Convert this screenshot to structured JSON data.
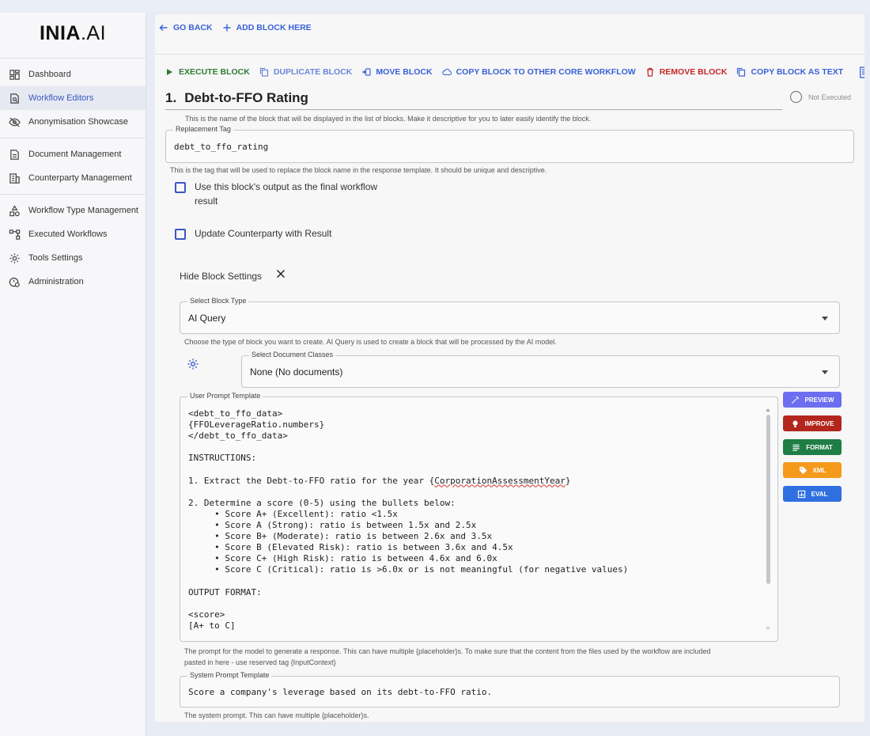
{
  "app": {
    "logo_bold": "INIA",
    "logo_rest": ".AI"
  },
  "sidebar": {
    "items": [
      {
        "label": "Dashboard",
        "icon": "dashboard-icon"
      },
      {
        "label": "Workflow Editors",
        "icon": "workflow-editor-icon",
        "active": true
      },
      {
        "label": "Anonymisation Showcase",
        "icon": "eye-off-icon"
      },
      {
        "label": "Document Management",
        "icon": "document-icon"
      },
      {
        "label": "Counterparty Management",
        "icon": "building-icon"
      },
      {
        "label": "Workflow Type Management",
        "icon": "shapes-icon"
      },
      {
        "label": "Executed Workflows",
        "icon": "flowchart-icon"
      },
      {
        "label": "Tools Settings",
        "icon": "gear-icon"
      },
      {
        "label": "Administration",
        "icon": "admin-icon"
      }
    ]
  },
  "topbar": {
    "go_back": "GO BACK",
    "add_block": "ADD BLOCK HERE"
  },
  "toolbar": {
    "execute": "EXECUTE BLOCK",
    "duplicate": "DUPLICATE BLOCK",
    "move": "MOVE BLOCK",
    "copy_other": "COPY BLOCK TO OTHER CORE WORKFLOW",
    "remove": "REMOVE BLOCK",
    "copy_text": "COPY BLOCK AS TEXT"
  },
  "block": {
    "number": "1.",
    "name": "Debt-to-FFO Rating",
    "status": "Not Executed",
    "name_help": "This is the name of the block that will be displayed in the list of blocks. Make it descriptive for you to later easily identify the block.",
    "tag_label": "Replacement Tag",
    "tag_value": "debt_to_ffo_rating",
    "tag_help": "This is the tag that will be used to replace the block name in the response template. It should be unique and descriptive.",
    "final_result_label_1": "Use this block's output as the final workflow",
    "final_result_label_2": "result",
    "update_cp_label": "Update Counterparty with Result",
    "hide_settings": "Hide Block Settings",
    "block_type_label": "Select Block Type",
    "block_type_value": "AI Query",
    "block_type_help": "Choose the type of block you want to create. AI Query is used to create a block that will be processed by the AI model.",
    "doc_classes_label": "Select Document Classes",
    "doc_classes_value": "None (No documents)",
    "user_prompt_label": "User Prompt Template",
    "user_prompt_before": "<debt_to_ffo_data>\n{FFOLeverageRatio.numbers}\n</debt_to_ffo_data>\n\nINSTRUCTIONS:\n\n1. Extract the Debt-to-FFO ratio for the year {",
    "user_prompt_misspelled": "CorporationAssessmentYear",
    "user_prompt_after": "}\n\n2. Determine a score (0-5) using the bullets below:\n     • Score A+ (Excellent): ratio <1.5x\n     • Score A (Strong): ratio is between 1.5x and 2.5x\n     • Score B+ (Moderate): ratio is between 2.6x and 3.5x\n     • Score B (Elevated Risk): ratio is between 3.6x and 4.5x\n     • Score C+ (High Risk): ratio is between 4.6x and 6.0x\n     • Score C (Critical): ratio is >6.0x or is not meaningful (for negative values)\n\nOUTPUT FORMAT:\n\n<score>\n[A+ to C]",
    "user_prompt_help_1": "The prompt for the model to generate a response. This can have multiple {placeholder}s. To make sure that the content from the files used by the workflow are included",
    "user_prompt_help_2": "pasted in here - use reserved tag {InputContext}",
    "system_prompt_label": "System Prompt Template",
    "system_prompt_value": "Score a company's leverage based on its debt-to-FFO ratio.",
    "system_prompt_help": "The system prompt. This can have multiple {placeholder}s."
  },
  "side_buttons": [
    {
      "label": "PREVIEW",
      "color": "#6b6ef0",
      "icon": "magic-wand-icon"
    },
    {
      "label": "IMPROVE",
      "color": "#b3261e",
      "icon": "lightbulb-icon"
    },
    {
      "label": "FORMAT",
      "color": "#1e7e45",
      "icon": "format-lines-icon"
    },
    {
      "label": "XML",
      "color": "#f59a1b",
      "icon": "tag-icon"
    },
    {
      "label": "EVAL",
      "color": "#2f6fe0",
      "icon": "chart-icon"
    }
  ]
}
